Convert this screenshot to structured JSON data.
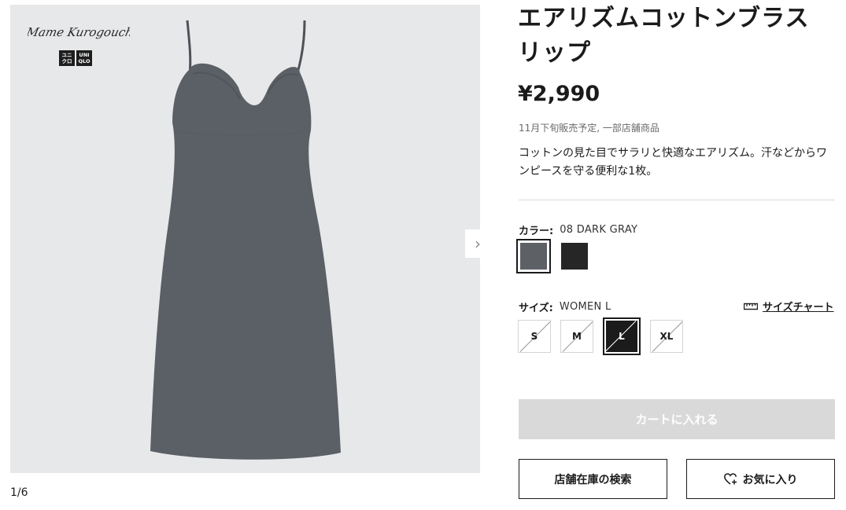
{
  "gallery": {
    "brand_logo_text": "Mame Kurogouchi",
    "uniqlo_logo": {
      "left": "ユニ\nクロ",
      "right": "UNI\nQLO"
    },
    "counter": "1/6",
    "next_icon": "chevron-right-icon",
    "product_color": "#5b6066"
  },
  "product": {
    "title": "エアリズムコットンブラスリップ",
    "price": "¥2,990",
    "release_note": "11月下旬販売予定, 一部店舗商品",
    "description": "コットンの見た目でサラリと快適なエアリズム。汗などからワンピースを守る便利な1枚。"
  },
  "color": {
    "label": "カラー:",
    "value": "08 DARK GRAY",
    "swatches": [
      {
        "name": "DARK GRAY",
        "hex": "#5d6166",
        "selected": true
      },
      {
        "name": "BLACK",
        "hex": "#262626",
        "selected": false
      }
    ]
  },
  "size": {
    "label": "サイズ:",
    "value": "WOMEN L",
    "chart_link": "サイズチャート",
    "chart_icon": "ruler-icon",
    "options": [
      {
        "label": "S",
        "selected": false
      },
      {
        "label": "M",
        "selected": false
      },
      {
        "label": "L",
        "selected": true
      },
      {
        "label": "XL",
        "selected": false
      }
    ]
  },
  "actions": {
    "add_to_cart": "カートに入れる",
    "store_stock": "店舗在庫の検索",
    "favorite": "お気に入り",
    "favorite_icon": "heart-plus-icon"
  }
}
